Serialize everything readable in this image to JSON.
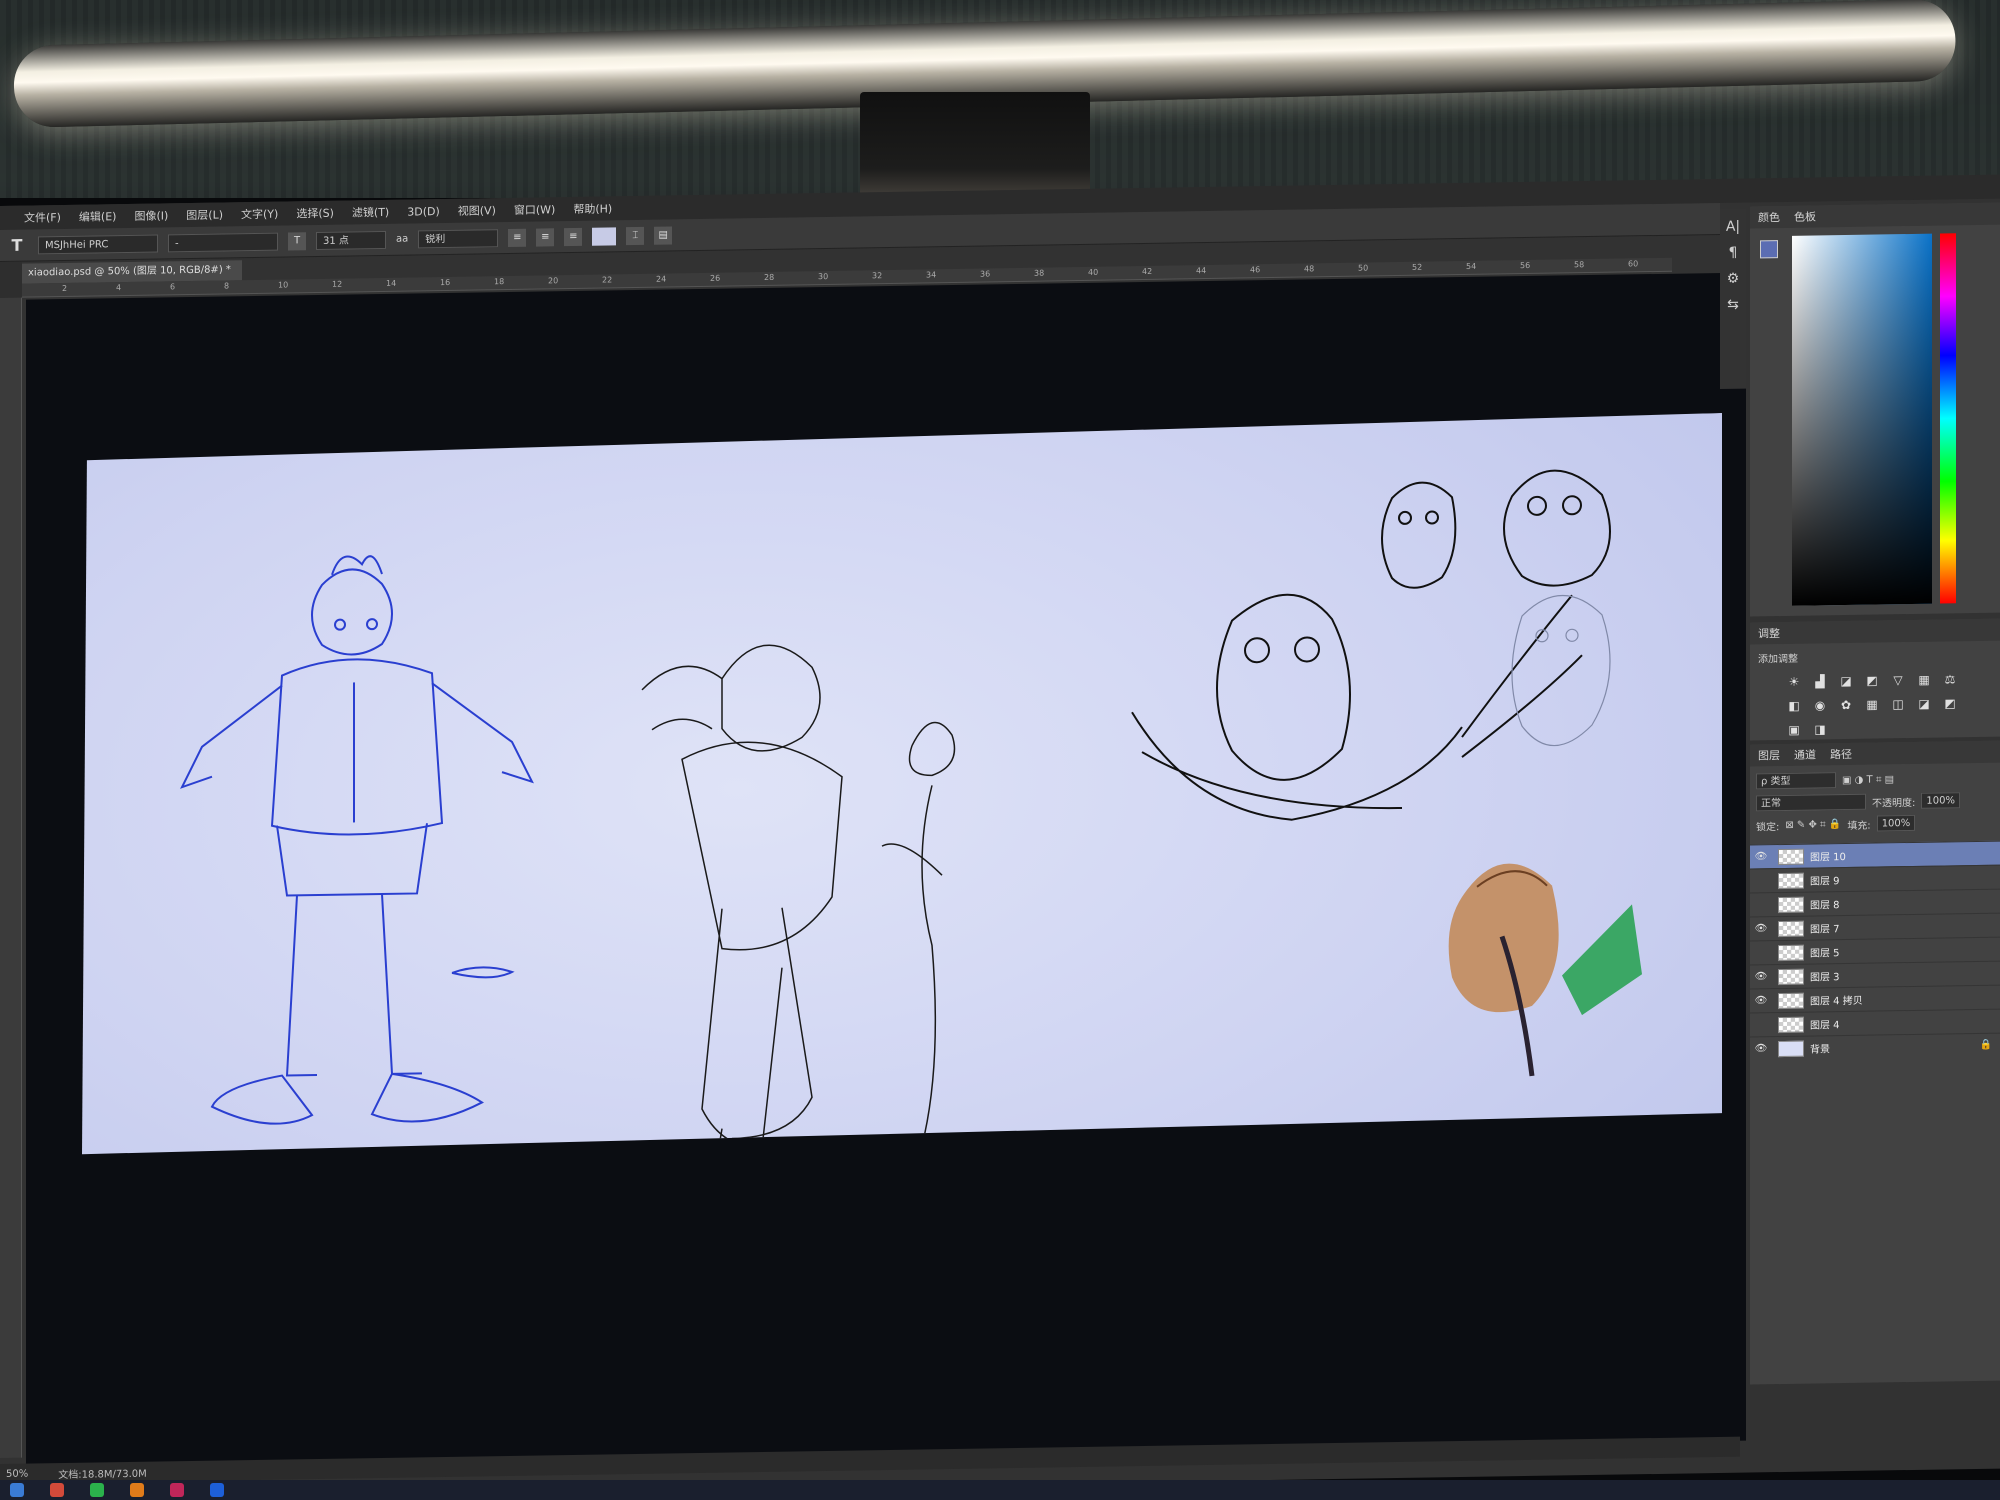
{
  "menu": [
    "文件(F)",
    "编辑(E)",
    "图像(I)",
    "图层(L)",
    "文字(Y)",
    "选择(S)",
    "滤镜(T)",
    "3D(D)",
    "视图(V)",
    "窗口(W)",
    "帮助(H)"
  ],
  "options": {
    "tool": "T",
    "font_family": "MSJhHei PRC",
    "font_style": "-",
    "font_size": "31 点",
    "aa_label": "aa",
    "antialias": "锐利"
  },
  "document_tab": "xiaodiao.psd @ 50% (图层 10, RGB/8#) *",
  "ruler_ticks": [
    "2",
    "4",
    "6",
    "8",
    "10",
    "12",
    "14",
    "16",
    "18",
    "20",
    "22",
    "24",
    "26",
    "28",
    "30",
    "32",
    "34",
    "36",
    "38",
    "40",
    "42",
    "44",
    "46",
    "48",
    "50",
    "52",
    "54",
    "56",
    "58",
    "60"
  ],
  "panels": {
    "color_tabs": [
      "颜色",
      "色板"
    ],
    "adjust_tab": "调整",
    "adjust_label": "添加调整",
    "layers_tabs": [
      "图层",
      "通道",
      "路径"
    ],
    "filter_kind": "ρ 类型",
    "blend_mode": "正常",
    "opacity_label": "不透明度:",
    "opacity_value": "100%",
    "lock_label": "锁定:",
    "fill_label": "填充:",
    "fill_value": "100%"
  },
  "layers": [
    {
      "name": "图层 10",
      "visible": true,
      "selected": true
    },
    {
      "name": "图层 9",
      "visible": false,
      "selected": false
    },
    {
      "name": "图层 8",
      "visible": false,
      "selected": false
    },
    {
      "name": "图层 7",
      "visible": true,
      "selected": false
    },
    {
      "name": "图层 5",
      "visible": false,
      "selected": false
    },
    {
      "name": "图层 3",
      "visible": true,
      "selected": false
    },
    {
      "name": "图层 4 拷贝",
      "visible": true,
      "selected": false
    },
    {
      "name": "图层 4",
      "visible": false,
      "selected": false
    },
    {
      "name": "背景",
      "visible": true,
      "selected": false,
      "locked": true
    }
  ],
  "status": {
    "zoom": "50%",
    "doc_size": "文档:18.8M/73.0M"
  },
  "colors": {
    "accent": "#6b7fb5",
    "sketch_blue": "#2a3fd0",
    "sketch_black": "#111111"
  },
  "icons": [
    "eye-icon",
    "lock-icon",
    "type-tool-icon",
    "align-icon",
    "color-picker-icon"
  ]
}
